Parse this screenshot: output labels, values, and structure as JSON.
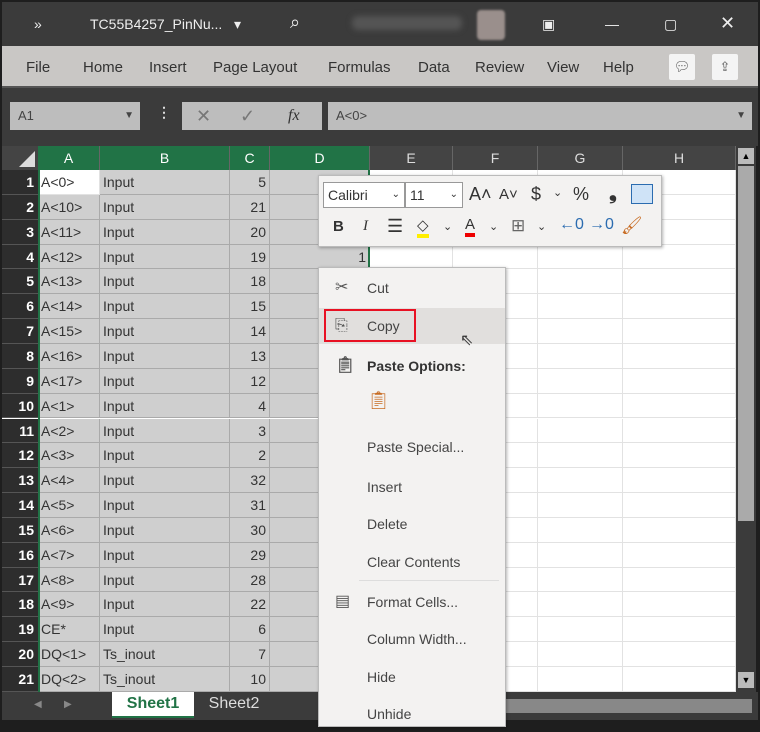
{
  "titlebar": {
    "overflow": "»",
    "filename": "TC55B4257_PinNu...",
    "dropdown": "▾"
  },
  "ribbon": {
    "tabs": [
      "File",
      "Home",
      "Insert",
      "Page Layout",
      "Formulas",
      "Data",
      "Review",
      "View",
      "Help"
    ]
  },
  "formula_bar": {
    "name_box": "A1",
    "cancel": "✕",
    "enter": "✓",
    "fx": "fx",
    "value": "A<0>"
  },
  "columns": [
    "A",
    "B",
    "C",
    "D",
    "E",
    "F",
    "G",
    "H"
  ],
  "selected_columns": [
    "A",
    "B",
    "C",
    "D"
  ],
  "rows": [
    [
      "A<0>",
      "Input",
      "5",
      ""
    ],
    [
      "A<10>",
      "Input",
      "21",
      ""
    ],
    [
      "A<11>",
      "Input",
      "20",
      ""
    ],
    [
      "A<12>",
      "Input",
      "19",
      "1"
    ],
    [
      "A<13>",
      "Input",
      "18",
      ""
    ],
    [
      "A<14>",
      "Input",
      "15",
      ""
    ],
    [
      "A<15>",
      "Input",
      "14",
      ""
    ],
    [
      "A<16>",
      "Input",
      "13",
      ""
    ],
    [
      "A<17>",
      "Input",
      "12",
      ""
    ],
    [
      "A<1>",
      "Input",
      "4",
      ""
    ],
    [
      "A<2>",
      "Input",
      "3",
      ""
    ],
    [
      "A<3>",
      "Input",
      "2",
      ""
    ],
    [
      "A<4>",
      "Input",
      "32",
      ""
    ],
    [
      "A<5>",
      "Input",
      "31",
      ""
    ],
    [
      "A<6>",
      "Input",
      "30",
      ""
    ],
    [
      "A<7>",
      "Input",
      "29",
      ""
    ],
    [
      "A<8>",
      "Input",
      "28",
      ""
    ],
    [
      "A<9>",
      "Input",
      "22",
      ""
    ],
    [
      "CE*",
      "Input",
      "6",
      ""
    ],
    [
      "DQ<1>",
      "Ts_inout",
      "7",
      ""
    ],
    [
      "DQ<2>",
      "Ts_inout",
      "10",
      ""
    ]
  ],
  "sheets": {
    "tabs": [
      "Sheet1",
      "Sheet2"
    ],
    "active": "Sheet1"
  },
  "mini_toolbar": {
    "font": "Calibri",
    "size": "11",
    "bold": "B",
    "italic": "I",
    "currency": "$",
    "percent": "%",
    "comma": "❟"
  },
  "context_menu": {
    "items": [
      "Cut",
      "Copy",
      "Paste Options:",
      "Paste Special...",
      "Insert",
      "Delete",
      "Clear Contents",
      "Format Cells...",
      "Column Width...",
      "Hide",
      "Unhide"
    ],
    "highlighted": "Copy"
  },
  "colors": {
    "accent": "#217346",
    "highlight_border": "#e81123"
  }
}
